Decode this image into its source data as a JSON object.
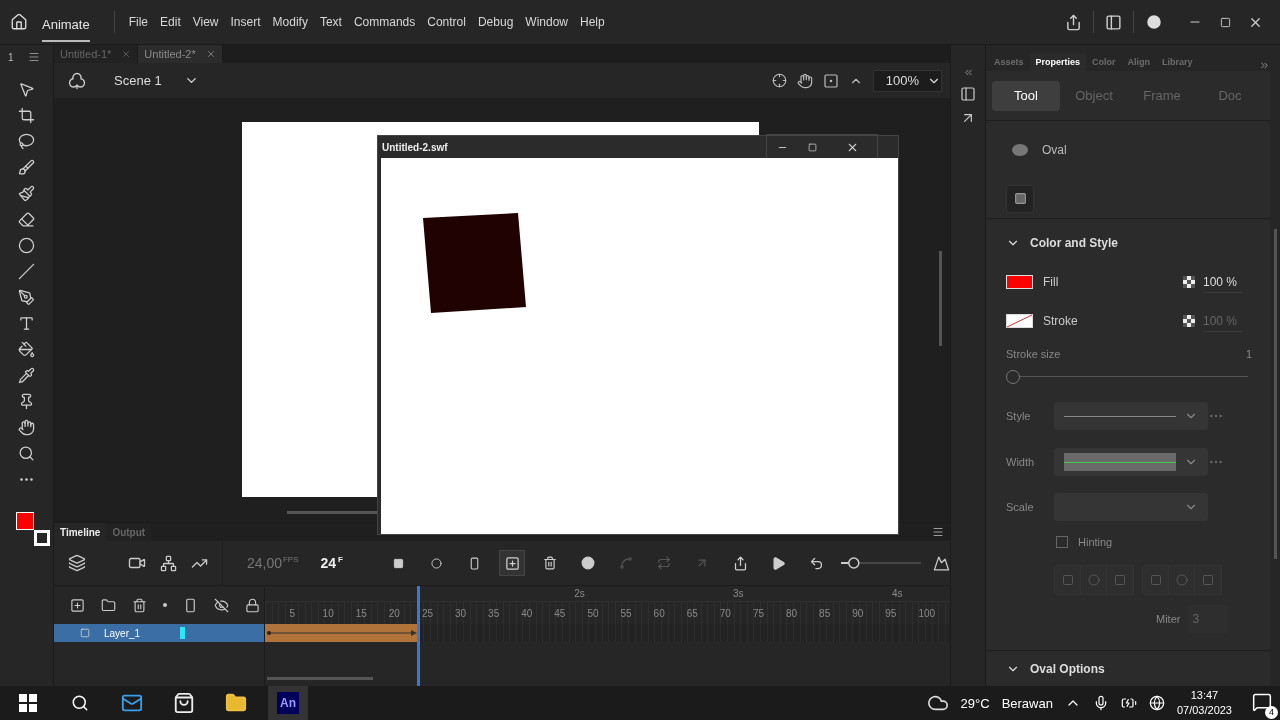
{
  "app": {
    "name": "Animate"
  },
  "menu": [
    "File",
    "Edit",
    "View",
    "Insert",
    "Modify",
    "Text",
    "Commands",
    "Control",
    "Debug",
    "Window",
    "Help"
  ],
  "tools_page": "1",
  "doc_tabs": [
    {
      "label": "Untitled-1*",
      "selected": false
    },
    {
      "label": "Untitled-2*",
      "selected": true
    }
  ],
  "scene": {
    "label": "Scene 1",
    "zoom": "100%"
  },
  "swf_window": {
    "title": "Untitled-2.swf"
  },
  "timeline": {
    "tabs": [
      {
        "label": "Timeline",
        "selected": true
      },
      {
        "label": "Output",
        "selected": false
      }
    ],
    "fps": "24,00",
    "fps_unit": "FPS",
    "frame": "24",
    "frame_unit": "F",
    "seconds": [
      "2s",
      "3s",
      "4s"
    ],
    "zoom_slider": {
      "level": 0.1
    },
    "frame_numbers": [
      "5",
      "10",
      "15",
      "20",
      "25",
      "30",
      "35",
      "40",
      "45",
      "50",
      "55",
      "60",
      "65",
      "70",
      "75",
      "80",
      "85",
      "90",
      "95",
      "100"
    ],
    "layers": [
      {
        "name": "Layer_1",
        "selected": true
      }
    ]
  },
  "properties": {
    "tabs": [
      {
        "label": "Assets",
        "selected": false
      },
      {
        "label": "Properties",
        "selected": true
      },
      {
        "label": "Color",
        "selected": false
      },
      {
        "label": "Align",
        "selected": false
      },
      {
        "label": "Library",
        "selected": false
      }
    ],
    "modes": [
      {
        "label": "Tool",
        "selected": true
      },
      {
        "label": "Object",
        "selected": false
      },
      {
        "label": "Frame",
        "selected": false
      },
      {
        "label": "Doc",
        "selected": false
      }
    ],
    "tool": "Oval",
    "section": "Color and Style",
    "fill": {
      "label": "Fill",
      "color": "#ff0000",
      "alpha": "100 %"
    },
    "stroke": {
      "label": "Stroke",
      "alpha": "100 %"
    },
    "stroke_size": {
      "label": "Stroke size",
      "value": "1",
      "level": 0
    },
    "style_label": "Style",
    "width_label": "Width",
    "scale_label": "Scale",
    "hinting": {
      "label": "Hinting",
      "checked": false
    },
    "miter": {
      "label": "Miter",
      "value": "3"
    },
    "oval_options": "Oval Options"
  },
  "taskbar": {
    "animate_logo": "An",
    "temperature": "29°C",
    "weather": "Berawan",
    "time": "13:47",
    "date": "07/03/2023",
    "notifications": "4"
  }
}
